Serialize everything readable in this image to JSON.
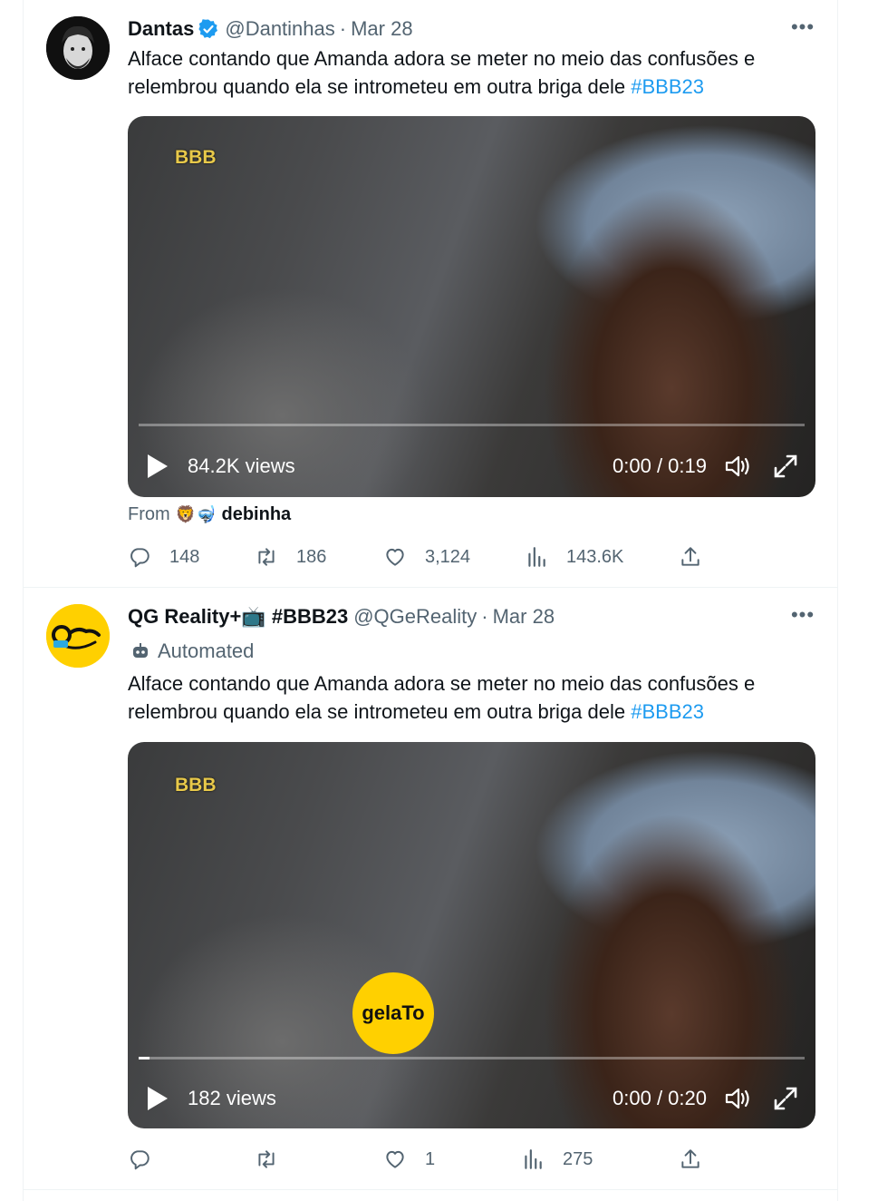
{
  "tweets": [
    {
      "author": {
        "name": "Dantas",
        "handle": "@Dantinhas",
        "dot": "·",
        "date": "Mar 28",
        "verified": true
      },
      "text": "Alface contando que Amanda adora se meter no meio das confusões e relembrou quando ela se intrometeu em outra briga dele ",
      "hashtag": "#BBB23",
      "video": {
        "watermark": "BBB",
        "views": "84.2K views",
        "time": "0:00 / 0:19",
        "progress": 0
      },
      "from": {
        "label": "From",
        "emoji": "🦁🤿",
        "name": "debinha"
      },
      "actions": {
        "replies": "148",
        "retweets": "186",
        "likes": "3,124",
        "views": "143.6K"
      }
    },
    {
      "author": {
        "name": "QG Reality+📺 #BBB23",
        "handle": "@QGeReality",
        "dot": "·",
        "date": "Mar 28",
        "verified": false
      },
      "automated_label": "Automated",
      "text": "Alface contando que Amanda adora se meter no meio das confusões e relembrou quando ela se intrometeu em outra briga dele ",
      "hashtag": "#BBB23",
      "video": {
        "watermark": "BBB",
        "overlay_logo": "gelaTo",
        "views": "182 views",
        "time": "0:00 / 0:20",
        "progress": 0.017
      },
      "actions": {
        "replies": "",
        "retweets": "",
        "likes": "1",
        "views": "275"
      }
    }
  ],
  "icons": {
    "more": "more-icon",
    "verified": "verified-badge-icon",
    "reply": "reply-icon",
    "retweet": "retweet-icon",
    "like": "heart-icon",
    "views": "analytics-icon",
    "share": "share-icon",
    "play": "play-icon",
    "volume": "volume-icon",
    "fullscreen": "fullscreen-icon",
    "bot": "bot-icon"
  },
  "colors": {
    "link": "#1d9bf0",
    "muted": "#536471",
    "text": "#0f1419",
    "verified": "#1d9bf0"
  }
}
